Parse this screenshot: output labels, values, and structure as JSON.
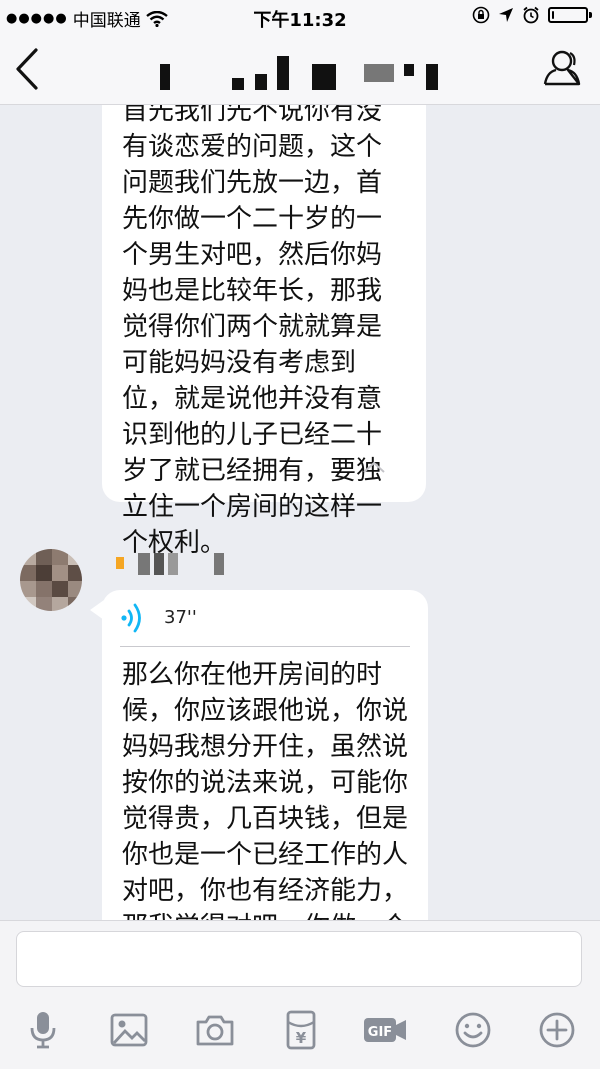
{
  "status_bar": {
    "signal": "●●●●●",
    "carrier": "中国联通",
    "time": "下午11:32"
  },
  "nav": {
    "back_icon": "chevron-left-icon",
    "contact_icon": "person-icon"
  },
  "messages": [
    {
      "text": "首先我们先不说你有没有谈恋爱的问题，这个问题我们先放一边，首先你做一个二十岁的一个男生对吧，然后你妈妈也是比较年长，那我觉得你们两个就就算是可能妈妈没有考虑到位，就是说他并没有意识到他的儿子已经二十岁了就已经拥有，要独立住一个房间的这样一个权利。"
    },
    {
      "voice_duration": "37''",
      "text": "那么你在他开房间的时候，你应该跟他说，你说妈妈我想分开住，虽然说按你的说法来说，可能你觉得贵，几百块钱，但是你也是一个已经工作的人对吧，你也有经济能力，那我觉得对吧，你做一个二十岁的人，不管有没有谈"
    }
  ],
  "toolbar": {
    "items": [
      "microphone-icon",
      "image-icon",
      "camera-icon",
      "red-packet-icon",
      "gif-icon",
      "emoji-icon",
      "plus-icon"
    ],
    "gif_label": "GIF",
    "red_packet_glyph": "¥"
  },
  "colors": {
    "accent": "#12b7f5",
    "background": "#ebedf2",
    "icon": "#8a8f99"
  }
}
